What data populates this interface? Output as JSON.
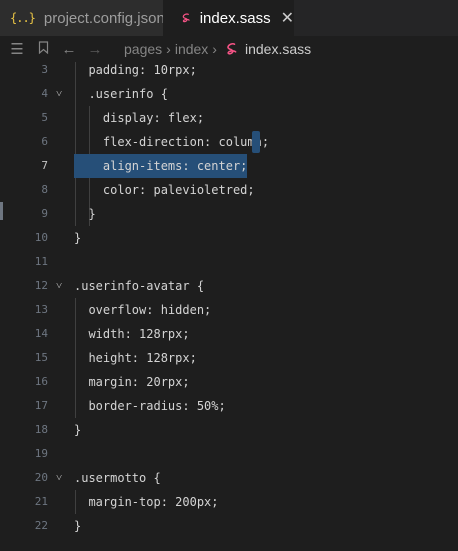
{
  "tabs": [
    {
      "icon": "json-braces-icon",
      "icon_text": "{..}",
      "label": "project.config.json",
      "active": false
    },
    {
      "icon": "sass-icon",
      "label": "index.sass",
      "active": true,
      "close": "✕"
    }
  ],
  "breadcrumbs": {
    "items": [
      "pages",
      "index",
      "index.sass"
    ],
    "separator": "›"
  },
  "editor": {
    "current_line": "7",
    "lines": [
      {
        "n": "3",
        "text": "  padding: 10rpx;"
      },
      {
        "n": "4",
        "text": "  .userinfo {"
      },
      {
        "n": "5",
        "text": "    display: flex;"
      },
      {
        "n": "6",
        "text": "    flex-direction: column;"
      },
      {
        "n": "7",
        "text": "    align-items: center;"
      },
      {
        "n": "8",
        "text": "    color: palevioletred;"
      },
      {
        "n": "9",
        "text": "  }"
      },
      {
        "n": "10",
        "text": "}"
      },
      {
        "n": "11",
        "text": ""
      },
      {
        "n": "12",
        "text": ".userinfo-avatar {"
      },
      {
        "n": "13",
        "text": "  overflow: hidden;"
      },
      {
        "n": "14",
        "text": "  width: 128rpx;"
      },
      {
        "n": "15",
        "text": "  height: 128rpx;"
      },
      {
        "n": "16",
        "text": "  margin: 20rpx;"
      },
      {
        "n": "17",
        "text": "  border-radius: 50%;"
      },
      {
        "n": "18",
        "text": "}"
      },
      {
        "n": "19",
        "text": ""
      },
      {
        "n": "20",
        "text": ".usermotto {"
      },
      {
        "n": "21",
        "text": "  margin-top: 200px;"
      },
      {
        "n": "22",
        "text": "}"
      }
    ],
    "fold_lines": [
      "4",
      "12",
      "20"
    ],
    "fold_glyph": "˅"
  },
  "colors": {
    "editor_bg": "#1e1e1e",
    "selection": "#264f78",
    "sass_pink": "#f55385",
    "json_yellow": "#e8c345"
  }
}
